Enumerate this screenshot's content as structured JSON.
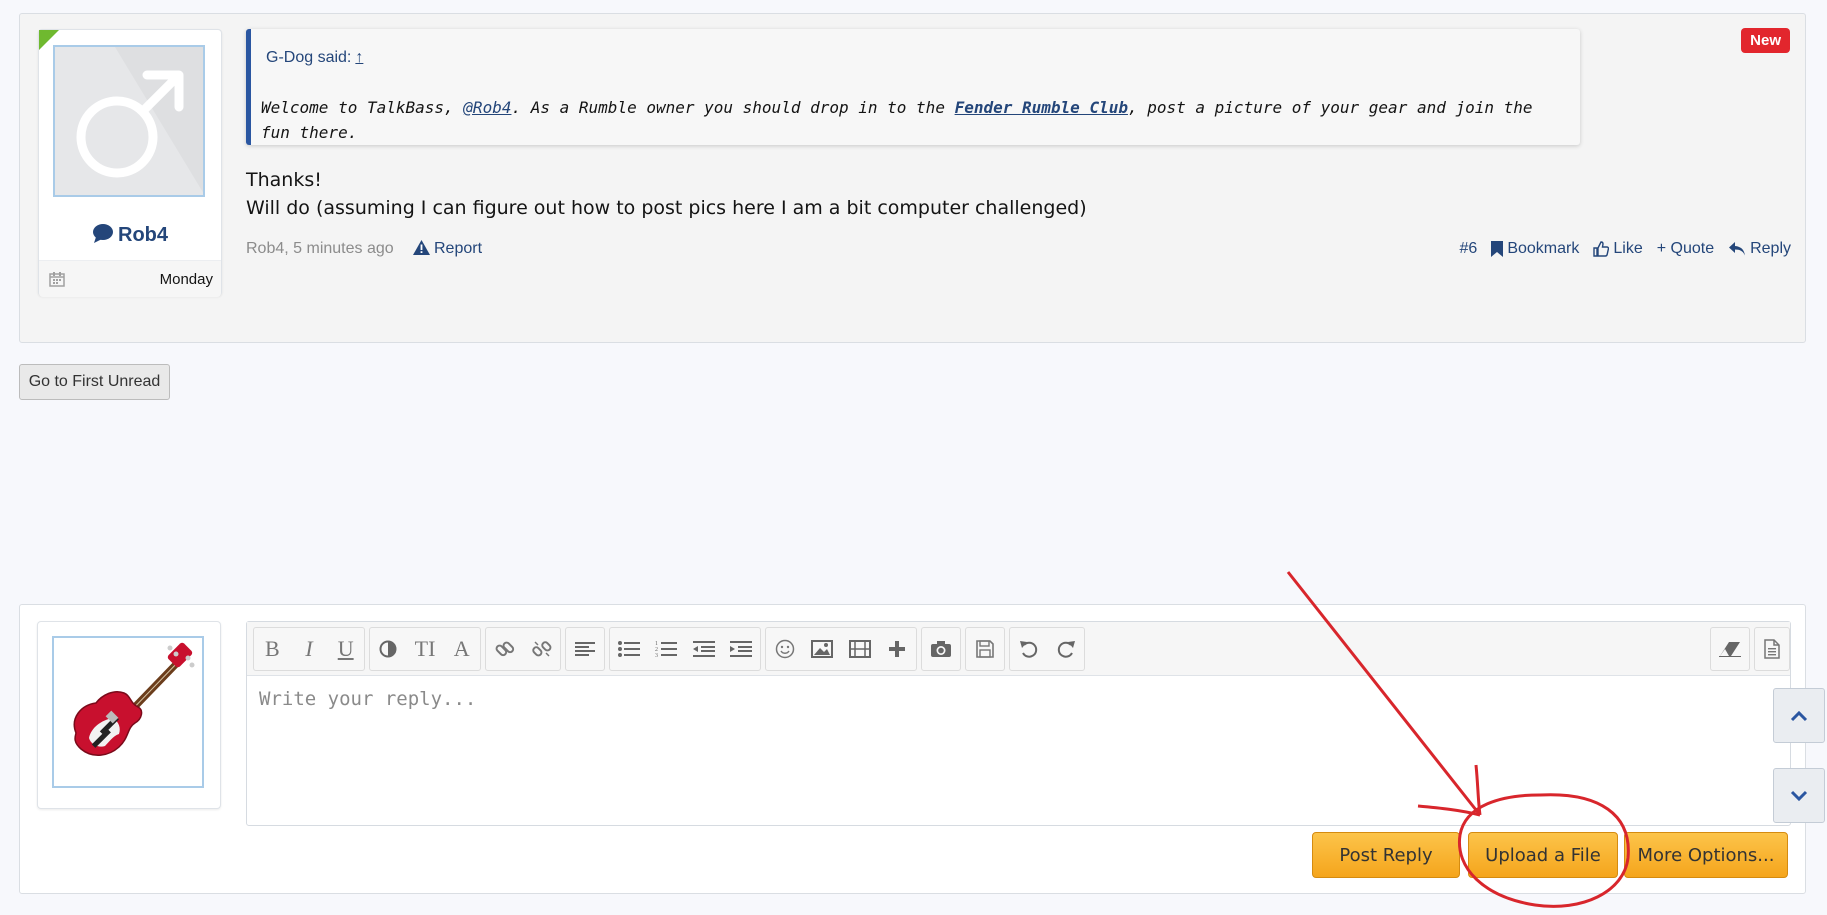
{
  "post": {
    "badge": "New",
    "quote": {
      "author_text": "G-Dog said:",
      "up_arrow": "↑",
      "text_1": "Welcome to TalkBass, ",
      "mention": "@Rob4",
      "text_2": ". As a Rumble owner you should drop in to the ",
      "club_link": "Fender Rumble Club",
      "text_3": ", post a picture of your gear and join the fun there."
    },
    "message_lines": [
      "Thanks!",
      "Will do (assuming I can figure out how to post pics here I am a bit computer challenged)"
    ],
    "meta": "Rob4, 5 minutes ago",
    "report_label": "Report",
    "actions": {
      "number": "#6",
      "bookmark": "Bookmark",
      "like": "Like",
      "quote": "+ Quote",
      "reply": "Reply"
    },
    "user": {
      "name": "Rob4",
      "joined": "Monday",
      "avatar_icon": "male-symbol-icon"
    }
  },
  "nav": {
    "first_unread": "Go to First Unread"
  },
  "reply": {
    "placeholder": "Write your reply...",
    "avatar_icon": "bass-guitar-icon",
    "toolbar_icons": [
      "bold-icon",
      "italic-icon",
      "underline-icon",
      "color-icon",
      "font-size-icon",
      "font-family-icon",
      "link-icon",
      "unlink-icon",
      "align-icon",
      "bullet-list-icon",
      "numbered-list-icon",
      "outdent-icon",
      "indent-icon",
      "smiley-icon",
      "image-icon",
      "media-icon",
      "insert-icon",
      "camera-icon",
      "save-draft-icon",
      "undo-icon",
      "redo-icon",
      "remove-format-icon",
      "bbcode-toggle-icon"
    ],
    "buttons": {
      "post_reply": "Post Reply",
      "upload": "Upload a File",
      "more": "More Options..."
    }
  },
  "colors": {
    "link": "#24467a",
    "button_orange": "#f5a51c",
    "new_badge": "#e2262d",
    "annotation": "#d8262c",
    "quote_bar": "#2a56a1"
  }
}
